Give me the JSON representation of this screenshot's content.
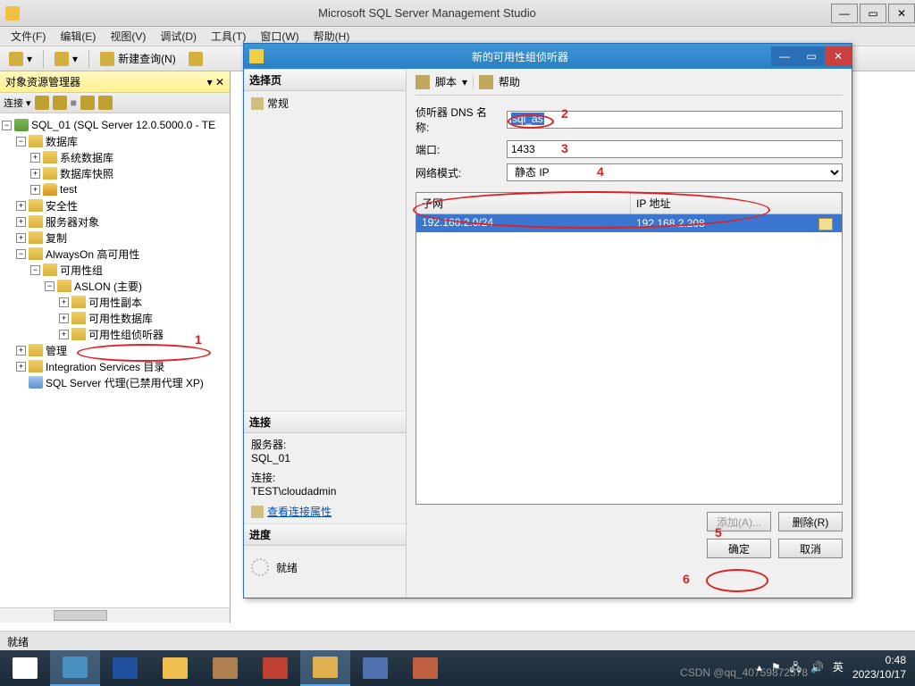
{
  "main_window": {
    "title": "Microsoft SQL Server Management Studio"
  },
  "menu": {
    "file": "文件(F)",
    "edit": "编辑(E)",
    "view": "视图(V)",
    "debug": "调试(D)",
    "tools": "工具(T)",
    "window": "窗口(W)",
    "help": "帮助(H)"
  },
  "toolbar": {
    "new_query": "新建查询(N)"
  },
  "object_explorer": {
    "title": "对象资源管理器",
    "connect_dd": "连接 ▾",
    "root": "SQL_01 (SQL Server 12.0.5000.0 - TE",
    "nodes": {
      "databases": "数据库",
      "sys_db": "系统数据库",
      "db_snapshot": "数据库快照",
      "test": "test",
      "security": "安全性",
      "server_objects": "服务器对象",
      "replication": "复制",
      "alwayson": "AlwaysOn 高可用性",
      "ag_group": "可用性组",
      "aslon": "ASLON (主要)",
      "replicas": "可用性副本",
      "ag_databases": "可用性数据库",
      "listeners": "可用性组侦听器",
      "management": "管理",
      "integration": "Integration Services 目录",
      "agent": "SQL Server 代理(已禁用代理 XP)"
    }
  },
  "dialog": {
    "title": "新的可用性组侦听器",
    "left": {
      "select_page": "选择页",
      "general": "常规",
      "connection": "连接",
      "server_label": "服务器:",
      "server_value": "SQL_01",
      "conn_label": "连接:",
      "conn_value": "TEST\\cloudadmin",
      "view_conn_props": "查看连接属性",
      "progress": "进度",
      "ready": "就绪"
    },
    "right_toolbar": {
      "script": "脚本",
      "help": "帮助"
    },
    "form": {
      "dns_label": "侦听器 DNS 名称:",
      "dns_value": "sql_as",
      "port_label": "端口:",
      "port_value": "1433",
      "netmode_label": "网络模式:",
      "netmode_value": "静态 IP"
    },
    "subnet_table": {
      "col_subnet": "子网",
      "col_ip": "IP 地址",
      "rows": [
        {
          "subnet": "192.168.2.0/24",
          "ip": "192.168.2.208"
        }
      ]
    },
    "buttons": {
      "add": "添加(A)...",
      "remove": "删除(R)",
      "ok": "确定",
      "cancel": "取消"
    }
  },
  "status": {
    "ready": "就绪"
  },
  "taskbar": {
    "time": "0:48",
    "date": "2023/10/17",
    "ime": "英",
    "watermark": "CSDN @qq_40759872578"
  },
  "annotations": {
    "a1": "1",
    "a2": "2",
    "a3": "3",
    "a4": "4",
    "a5": "5",
    "a6": "6"
  }
}
